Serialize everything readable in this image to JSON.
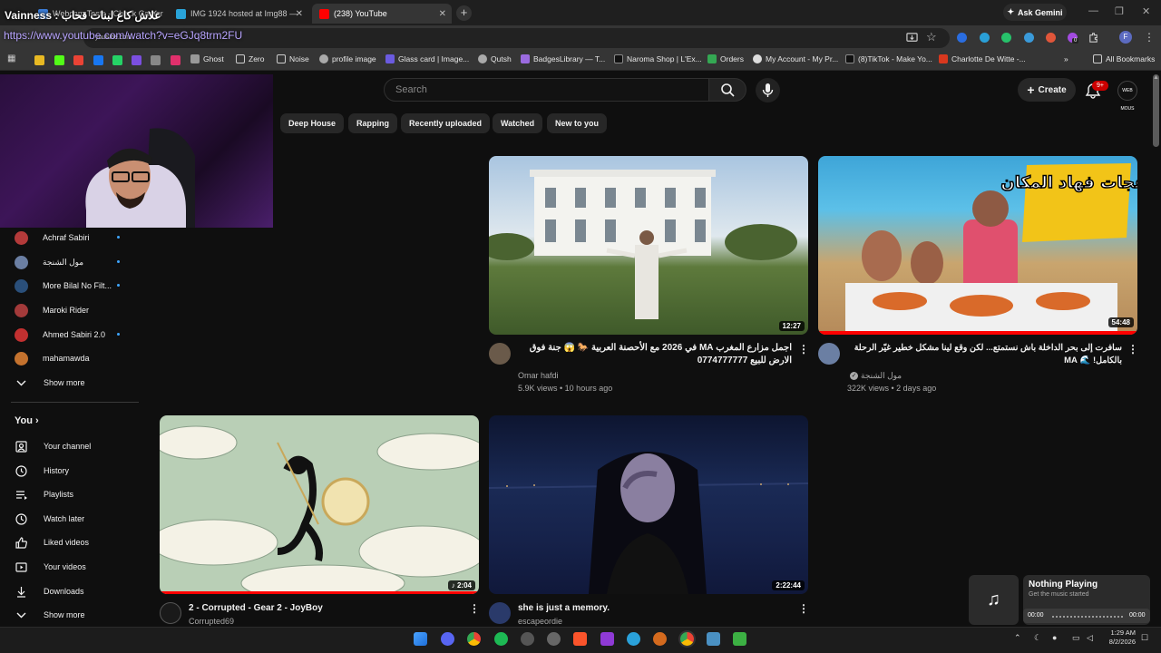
{
  "browser": {
    "tabs": [
      {
        "label": "Webcam Tests - Check Camera",
        "color": "#3a7bd5"
      },
      {
        "label": "IMG 1924 hosted at Img88 —",
        "color": "#29a3d8"
      },
      {
        "label": "(238) YouTube",
        "color": "#ff0000"
      }
    ],
    "gemini_label": "Ask Gemini",
    "profile_letter": "F",
    "ext_badge": "0",
    "bookmarks": [
      "Ghost",
      "Zero",
      "Noise",
      "profile image",
      "Glass card | Image...",
      "Qutsh",
      "BadgesLibrary — T...",
      "Naroma Shop | L'Ex...",
      "Orders",
      "My Account - My Pr...",
      "(8)TikTok - Make Yo...",
      "Charlotte De Witte -..."
    ],
    "all_bookmarks": "All Bookmarks",
    "bookmarks_overflow": "»"
  },
  "overlay": {
    "title": "Vainness : علاش كاع لبنات قحاب",
    "url": "https://www.youtube.com/watch?v=eGJq8trm2FU",
    "url_underlay": "youtube.com"
  },
  "youtube": {
    "search_placeholder": "Search",
    "create_label": "Create",
    "notif_badge": "9+",
    "avatar_text": "WEB MOUS",
    "chips": [
      "Deep House",
      "Rapping",
      "Recently uploaded",
      "Watched",
      "New to you"
    ],
    "subscriptions": [
      {
        "name": "Achraf Sabiri",
        "color": "#b33a3a"
      },
      {
        "name": "مول الشنجة",
        "color": "#6b7fa3"
      },
      {
        "name": "More Bilal No Filt...",
        "color": "#2a4f7a"
      },
      {
        "name": "Maroki Rider",
        "color": "#a33a3a"
      },
      {
        "name": "Ahmed Sabiri 2.0",
        "color": "#c23030"
      },
      {
        "name": "mahamawda",
        "color": "#c4722e"
      }
    ],
    "show_more": "Show more",
    "you_label": "You",
    "you_chevron": "›",
    "you_items": [
      "Your channel",
      "History",
      "Playlists",
      "Watch later",
      "Liked videos",
      "Your videos",
      "Downloads",
      "Show more"
    ],
    "videos": [
      {
        "title": "اجمل مزارع المغرب MA في 2026 مع الأحصنة العربية 🐎 😱 جنة فوق الارض للبيع 0774777777",
        "channel": "Omar hafdi",
        "meta": "5.9K views • 10 hours ago",
        "duration": "12:27"
      },
      {
        "title": "سافرت إلى بحر الداخلة باش نستمتع... لكن وقع لينا مشكل خطير غيّر الرحلة بالكامل! 🌊 MA",
        "channel": "مول الشنجة",
        "meta": "322K views • 2 days ago",
        "duration": "54:48",
        "thumb_text": "تفجات فهاد المكان"
      },
      {
        "title": "2 - Corrupted - Gear 2 - JoyBoy",
        "channel": "Corrupted69",
        "meta": "",
        "duration": "2:04"
      },
      {
        "title": "she is just a memory.",
        "channel": "escapeordie",
        "meta": "",
        "duration": "2:22:44"
      }
    ]
  },
  "media": {
    "title": "Nothing Playing",
    "subtitle": "Get the music started",
    "time_start": "00:00",
    "time_end": "00:00"
  },
  "taskbar": {
    "time": "1:29 AM",
    "date": "8/2/2026"
  }
}
